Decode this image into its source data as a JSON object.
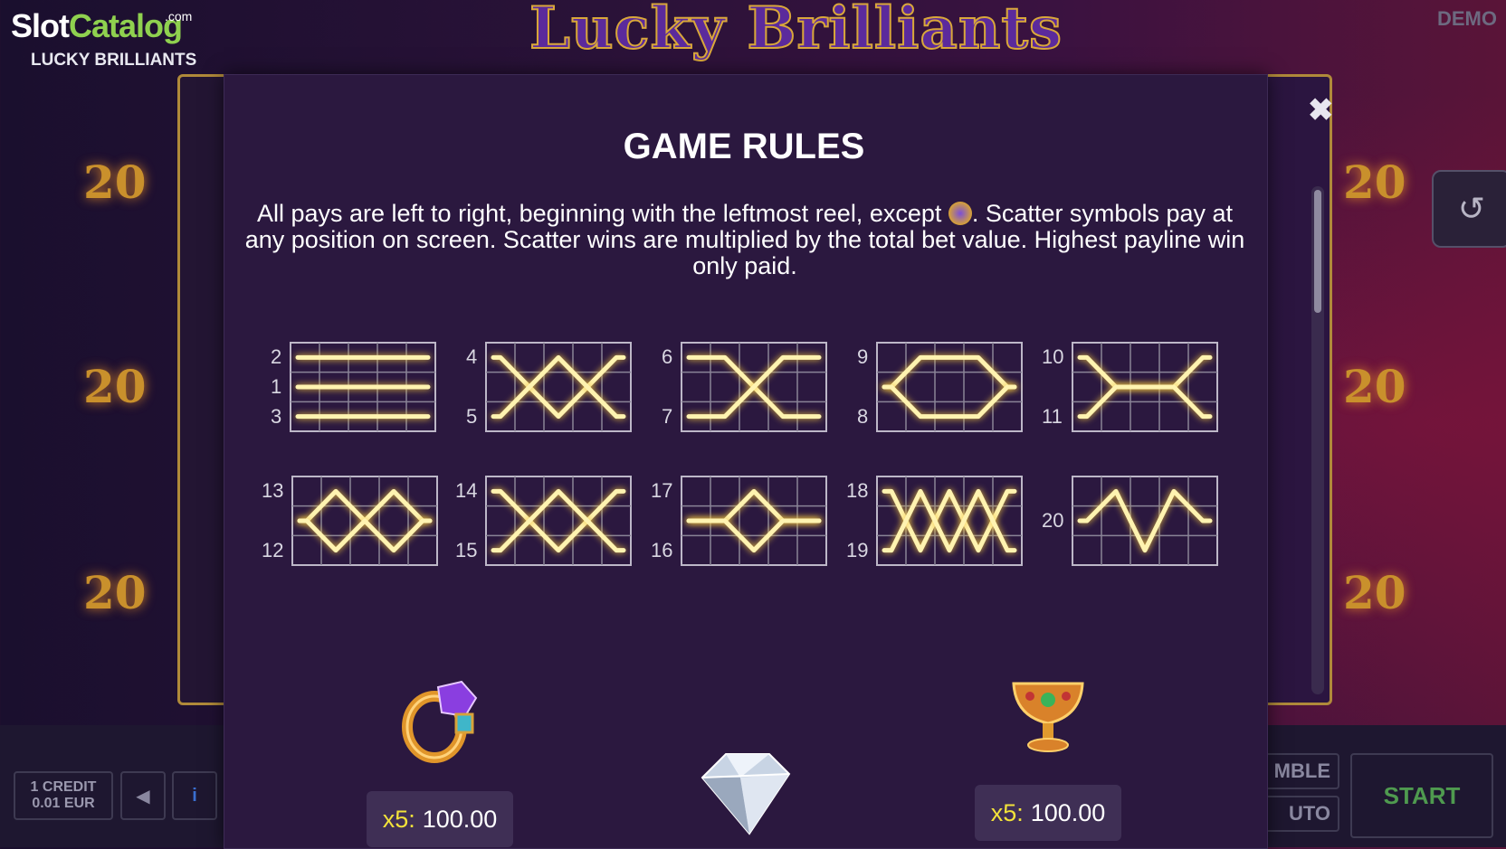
{
  "brand": {
    "name_part1": "Slot",
    "name_part2": "Catalog",
    "dotcom": ".com",
    "game_name": "LUCKY BRILLIANTS"
  },
  "header": {
    "logo_title": "Lucky Brilliants",
    "mode_label": "DEMO"
  },
  "background": {
    "side_value": "20"
  },
  "modal": {
    "title": "GAME RULES",
    "rules_text_part1": "All pays are left to right, beginning with the leftmost reel, except",
    "rules_text_part2": ". Scatter symbols pay at any position on screen. Scatter wins are multiplied by the total bet value. Highest payline win only paid.",
    "scatter_icon": "crown-icon",
    "close_icon": "close-icon"
  },
  "paylines": [
    {
      "labels": [
        "2",
        "1",
        "3"
      ]
    },
    {
      "labels": [
        "4",
        "5"
      ]
    },
    {
      "labels": [
        "6",
        "7"
      ]
    },
    {
      "labels": [
        "9",
        "8"
      ]
    },
    {
      "labels": [
        "10",
        "11"
      ]
    },
    {
      "labels": [
        "13",
        "12"
      ]
    },
    {
      "labels": [
        "14",
        "15"
      ]
    },
    {
      "labels": [
        "17",
        "16"
      ]
    },
    {
      "labels": [
        "18",
        "19"
      ]
    },
    {
      "labels": [
        "20"
      ]
    }
  ],
  "paytable": [
    {
      "symbol": "ring-icon",
      "multiplier": "x5:",
      "amount": "100.00"
    },
    {
      "symbol": "diamond-icon"
    },
    {
      "symbol": "goblet-icon",
      "multiplier": "x5:",
      "amount": "100.00"
    }
  ],
  "controls": {
    "credit_line1": "1 CREDIT",
    "credit_line2": "0.01 EUR",
    "sound_icon": "speaker-icon",
    "info_icon": "info-icon",
    "gamble_label": "MBLE",
    "auto_label": "UTO",
    "start_label": "START",
    "history_icon": "history-icon"
  },
  "colors": {
    "accent_gold": "#d9a73a",
    "payline_glow": "#fff3b0",
    "multiplier_yellow": "#f2e23a",
    "start_green": "#4f9a4f"
  }
}
